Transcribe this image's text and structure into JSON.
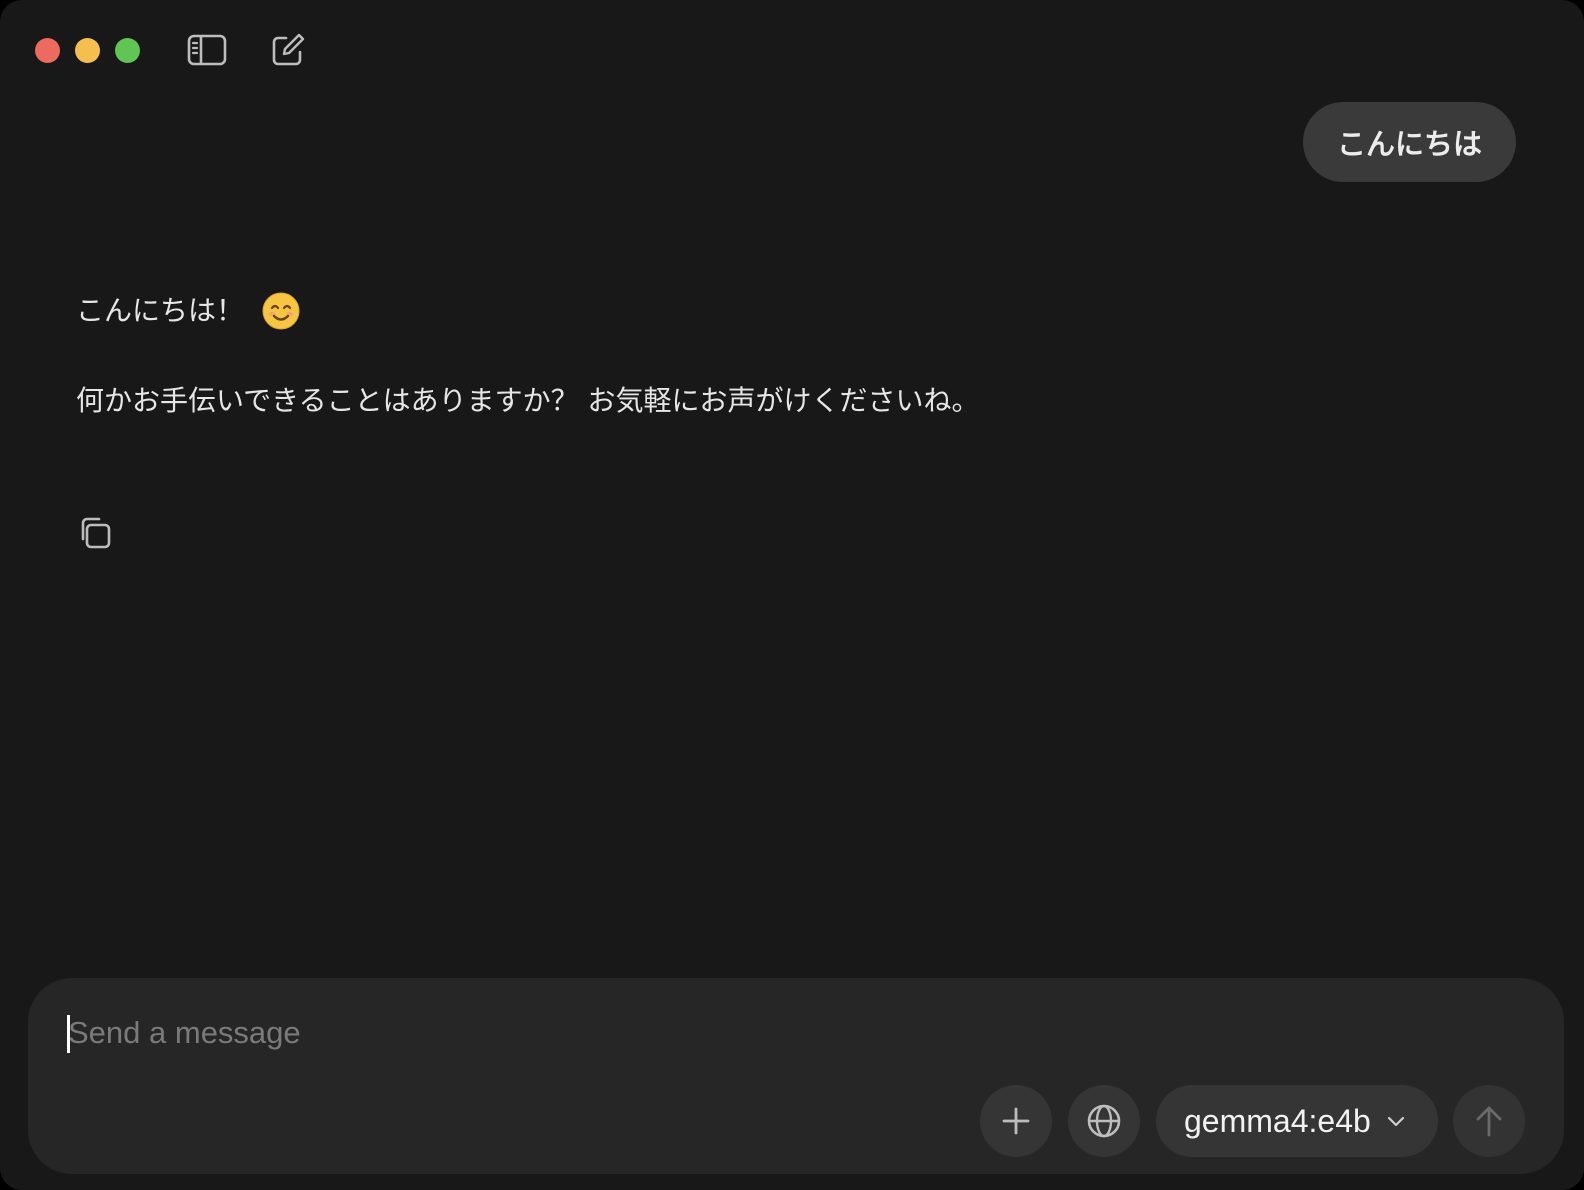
{
  "window": {
    "controls": [
      "close",
      "minimize",
      "maximize"
    ],
    "colors": {
      "close": "#ed6a5e",
      "minimize": "#f5bf4f",
      "maximize": "#61c554"
    }
  },
  "toolbar": {
    "icons": [
      "sidebar-toggle-icon",
      "new-chat-icon"
    ]
  },
  "conversation": {
    "user_message": "こんにちは",
    "assistant_line1": "こんにちは！",
    "assistant_emoji": "smiling-face-emoji",
    "assistant_line2": "何かお手伝いできることはありますか？ お気軽にお声がけくださいね。",
    "actions": [
      "copy-icon"
    ]
  },
  "composer": {
    "placeholder": "Send a message",
    "value": "",
    "buttons": [
      "plus-icon",
      "globe-icon",
      "arrow-up-icon"
    ],
    "model": "gemma4:e4b"
  }
}
